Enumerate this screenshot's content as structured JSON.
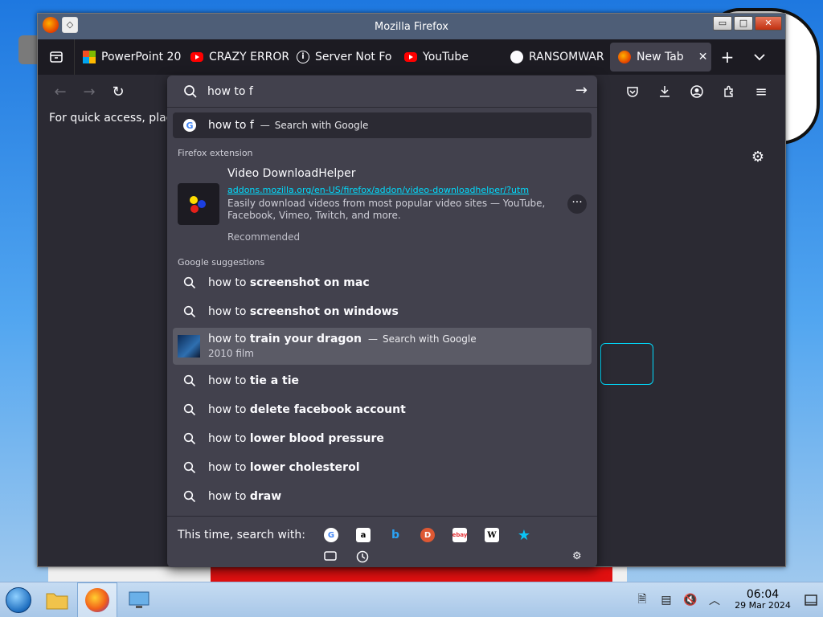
{
  "window": {
    "title": "Mozilla Firefox",
    "controls": {
      "minimize": "▭",
      "maximize": "□",
      "close": "✕"
    }
  },
  "tabs": [
    {
      "label": "PowerPoint 20",
      "icon": "microsoft-icon"
    },
    {
      "label": "CRAZY ERROR",
      "icon": "youtube-icon"
    },
    {
      "label": "Server Not Fo",
      "icon": "info-icon"
    },
    {
      "label": "YouTube",
      "icon": "youtube-icon"
    },
    {
      "label": "RANSOMWAR",
      "icon": "github-icon"
    },
    {
      "label": "New Tab",
      "icon": "firefox-icon",
      "active": true,
      "close": "✕"
    }
  ],
  "toolbar": {
    "back": "←",
    "forward": "→",
    "reload": "↻",
    "pocket": "pocket-icon",
    "downloads": "download-icon",
    "account": "account-icon",
    "extensions": "extensions-icon",
    "menu": "≡"
  },
  "bookmark_bar": {
    "text": "For quick access, plac"
  },
  "urlbar": {
    "value": "how to f",
    "go": "→"
  },
  "dropdown": {
    "heuristic": {
      "query": "how to f",
      "separator": "—",
      "action": "Search with Google"
    },
    "extension_section": "Firefox extension",
    "extension": {
      "title": "Video DownloadHelper",
      "url": "addons.mozilla.org/en-US/firefox/addon/video-downloadhelper/?utm",
      "description": "Easily download videos from most popular video sites — YouTube, Facebook, Vimeo, Twitch, and more.",
      "badge": "Recommended",
      "menu": "···"
    },
    "suggestions_section": "Google suggestions",
    "suggestions": [
      {
        "prefix": "how to ",
        "bold": "screenshot on mac"
      },
      {
        "prefix": "how to ",
        "bold": "screenshot on windows"
      },
      {
        "prefix": "how to ",
        "bold": "train your dragon",
        "separator": "—",
        "action": "Search with Google",
        "sub": "2010 film",
        "rich": true
      },
      {
        "prefix": "how to ",
        "bold": "tie a tie"
      },
      {
        "prefix": "how to ",
        "bold": "delete facebook account"
      },
      {
        "prefix": "how to ",
        "bold": "lower blood pressure"
      },
      {
        "prefix": "how to ",
        "bold": "lower cholesterol"
      },
      {
        "prefix": "how to ",
        "bold": "draw"
      }
    ],
    "engines_label": "This time, search with:",
    "engines": [
      {
        "name": "Google",
        "glyph": "G",
        "color": "#4285f4",
        "bg": "#ffffff"
      },
      {
        "name": "Amazon",
        "glyph": "a",
        "color": "#000000",
        "bg": "#ffffff"
      },
      {
        "name": "Bing",
        "glyph": "b",
        "color": "#2aa3f5",
        "bg": "transparent"
      },
      {
        "name": "DuckDuckGo",
        "glyph": "D",
        "color": "#ffffff",
        "bg": "#de5833"
      },
      {
        "name": "eBay",
        "glyph": "ebay",
        "color": "#e53238",
        "bg": "#ffffff"
      },
      {
        "name": "Wikipedia",
        "glyph": "W",
        "color": "#000000",
        "bg": "#ffffff"
      },
      {
        "name": "Bookmarks",
        "glyph": "★",
        "color": "#0ac4f5",
        "bg": "transparent"
      }
    ],
    "mode_icons": [
      "tabs-icon",
      "history-icon"
    ],
    "settings": "⚙"
  },
  "taskbar": {
    "apps": [
      "start-orb",
      "file-explorer",
      "firefox",
      "remote-desktop"
    ],
    "clock": {
      "time": "06:04",
      "date": "29 Mar 2024"
    },
    "tray": [
      "notes-icon",
      "clipboard-icon",
      "muted-speaker-icon",
      "chevron-up-icon",
      "show-desktop-icon"
    ]
  }
}
